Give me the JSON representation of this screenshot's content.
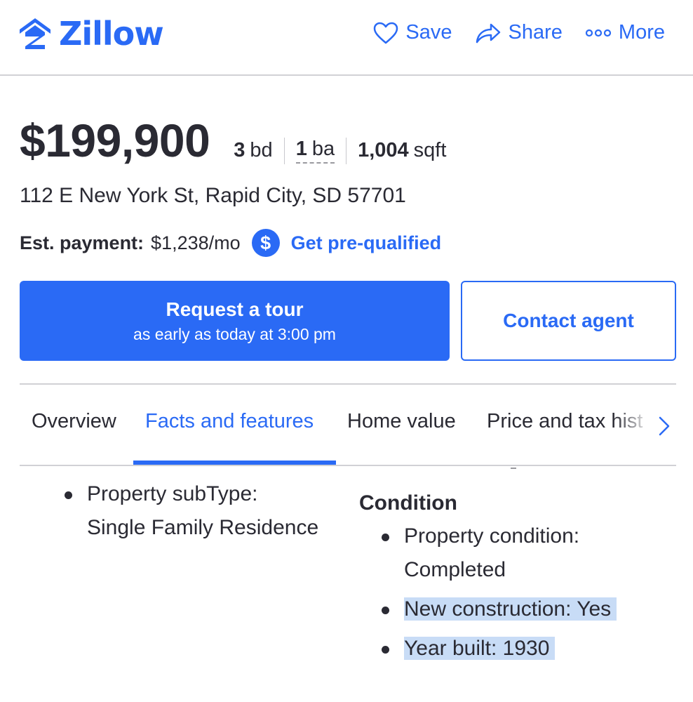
{
  "header": {
    "logo_text": "Zillow",
    "actions": [
      {
        "label": "Save",
        "icon": "heart-icon"
      },
      {
        "label": "Share",
        "icon": "share-icon"
      },
      {
        "label": "More",
        "icon": "more-dots-icon"
      }
    ]
  },
  "listing": {
    "price": "$199,900",
    "beds_value": "3",
    "beds_unit": "bd",
    "baths_value": "1",
    "baths_unit": "ba",
    "sqft_value": "1,004",
    "sqft_unit": "sqft",
    "address": "112 E New York St, Rapid City, SD 57701",
    "payment_label": "Est. payment:",
    "payment_value": "$1,238/mo",
    "payment_icon": "$",
    "prequal_label": "Get pre-qualified"
  },
  "cta": {
    "tour_title": "Request a tour",
    "tour_subtitle": "as early as today at 3:00 pm",
    "contact_label": "Contact agent"
  },
  "tabs": [
    {
      "label": "Overview",
      "active": false
    },
    {
      "label": "Facts and features",
      "active": true
    },
    {
      "label": "Home value",
      "active": false
    },
    {
      "label": "Price and tax hist",
      "active": false
    }
  ],
  "facts": {
    "left_items": [
      {
        "line1": "Property subType:",
        "line2": "Single Family Residence"
      }
    ],
    "condition_title": "Condition",
    "condition_items": [
      {
        "line1": "Property condition:",
        "line2": "Completed",
        "highlighted": false
      },
      {
        "line1": "New construction: Yes",
        "line2": "",
        "highlighted": true
      },
      {
        "line1": "Year built: 1930",
        "line2": "",
        "highlighted": true
      }
    ]
  },
  "colors": {
    "accent": "#2a6af5",
    "text": "#2a2a33",
    "highlight": "#c8dcf6",
    "divider": "#d1d1d5"
  }
}
